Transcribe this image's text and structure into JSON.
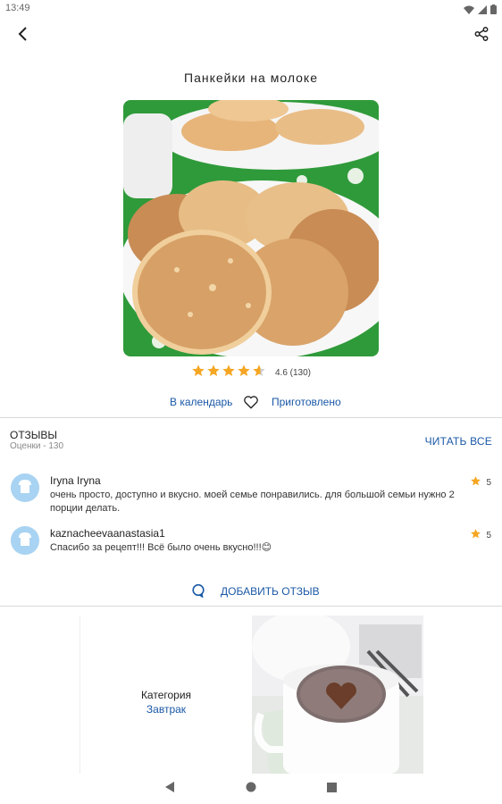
{
  "status": {
    "time": "13:49",
    "icons": [
      "wifi-icon",
      "signal-icon",
      "battery-icon"
    ]
  },
  "appbar": {
    "back_icon": "chevron-left-icon",
    "share_icon": "share-icon"
  },
  "recipe": {
    "title": "Панкейки на молоке",
    "rating_value": 4.6,
    "rating_text": "4.6 (130)",
    "stars_total": 5
  },
  "actions": {
    "calendar_label": "В календарь",
    "favorite_icon": "heart-icon",
    "cooked_label": "Приготовлено"
  },
  "reviews": {
    "title": "ОТЗЫВЫ",
    "count_label": "Оценки - 130",
    "read_all_label": "ЧИТАТЬ ВСЕ",
    "items": [
      {
        "name": "Iryna Iryna",
        "text": "очень просто, доступно и вкусно. моей семье понравились. для большой семьи нужно 2 порции делать.",
        "score": "5"
      },
      {
        "name": "kaznacheevaanastasia1",
        "text": "Спасибо за рецепт!!! Всё было очень вкусно!!!😊",
        "score": "5"
      }
    ],
    "add_label": "ДОБАВИТЬ ОТЗЫВ",
    "add_icon": "comment-icon"
  },
  "category": {
    "label": "Категория",
    "value": "Завтрак"
  },
  "nav": {
    "back_icon": "nav-back-icon",
    "home_icon": "nav-home-icon",
    "recents_icon": "nav-recents-icon"
  },
  "colors": {
    "accent": "#1a58a6",
    "star": "#f5a623",
    "avatar_bg": "#a9d3f2"
  }
}
